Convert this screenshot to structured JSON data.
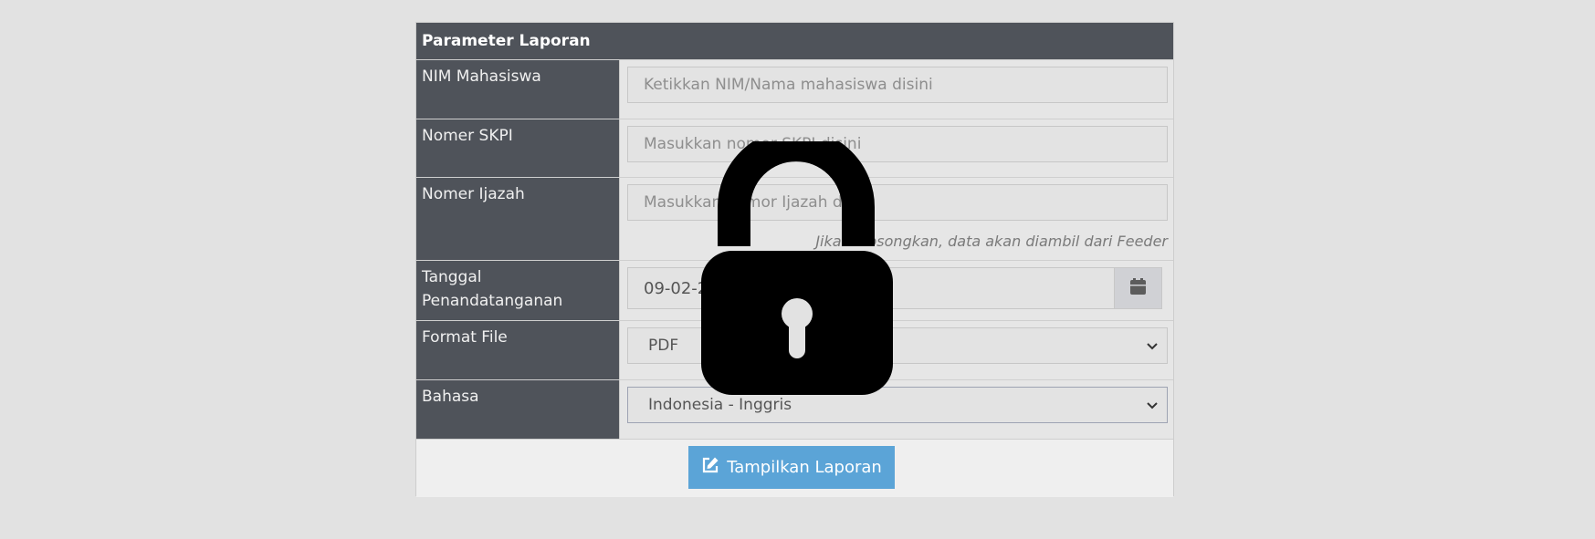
{
  "panel": {
    "title": "Parameter Laporan"
  },
  "fields": {
    "nim": {
      "label": "NIM Mahasiswa",
      "placeholder": "Ketikkan NIM/Nama mahasiswa disini"
    },
    "skpi": {
      "label": "Nomer SKPI",
      "placeholder": "Masukkan nomor SKPI disini"
    },
    "ijazah": {
      "label": "Nomer Ijazah",
      "placeholder": "Masukkan nomor Ijazah disini",
      "help": "Jika dikosongkan, data akan diambil dari Feeder"
    },
    "tanggal": {
      "label": "Tanggal Penandatanganan",
      "value": "09-02-2024",
      "icon": "calendar-icon"
    },
    "format": {
      "label": "Format File",
      "value": "PDF"
    },
    "bahasa": {
      "label": "Bahasa",
      "value": "Indonesia - Inggris"
    }
  },
  "actions": {
    "submit_label": "Tampilkan Laporan",
    "submit_icon": "edit-icon",
    "submit_color": "#5ba4d7"
  },
  "overlay": {
    "icon": "lock-icon"
  },
  "colors": {
    "header_bg": "#4f535a",
    "page_bg": "#e2e2e2"
  }
}
